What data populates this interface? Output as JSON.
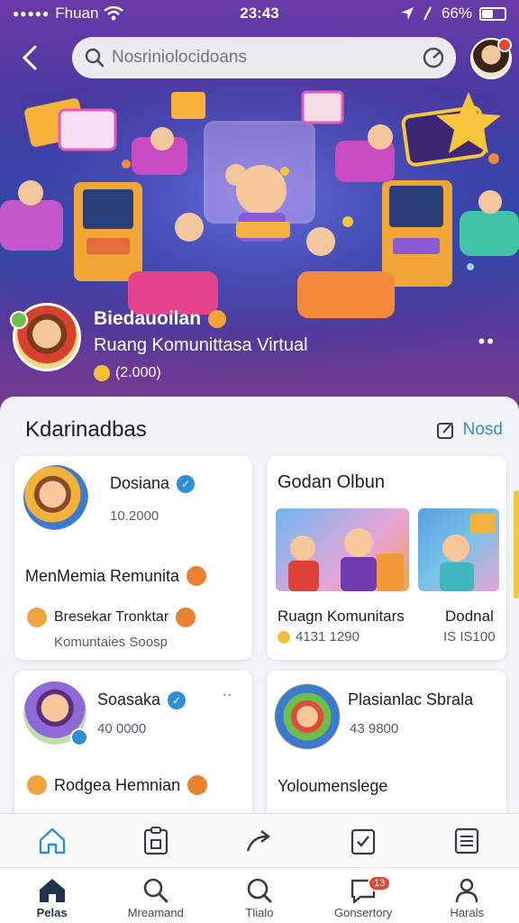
{
  "status_bar": {
    "carrier": "Fhuan",
    "time": "23:43",
    "battery": "66%"
  },
  "header": {
    "search_placeholder": "Nosriniolocidoans"
  },
  "hero": {
    "title": "Biedauoilan",
    "subtitle": "Ruang Komunittasa Virtual",
    "count": "(2.000)",
    "more": "••"
  },
  "section": {
    "title": "Kdarinadbas",
    "action_label": "Nosd"
  },
  "cards": [
    {
      "name": "Dosiana",
      "count": "10.2000",
      "line": "MenMemia Remunita",
      "tag": "Bresekar Tronktar",
      "sub": "Komuntaies Soosp"
    },
    {
      "title": "Godan Olbun",
      "caption_left": "Ruagn Komunitars",
      "caption_right": "Dodnal",
      "meta_left": "4131 1290",
      "meta_right": "IS IS100"
    },
    {
      "name": "Soasaka",
      "count": "40 0000",
      "line": "Rodgea Hemnian",
      "more": "··"
    },
    {
      "name": "Plasianlac Sbrala",
      "count": "43 9800",
      "line": "Yoloumenslege"
    }
  ],
  "nav": [
    {
      "label": "Pelas",
      "icon": "home-icon"
    },
    {
      "label": "Mreamand",
      "icon": "search-icon"
    },
    {
      "label": "Tlialo",
      "icon": "search-icon"
    },
    {
      "label": "Gonsertory",
      "icon": "chat-icon",
      "badge": "13"
    },
    {
      "label": "Harals",
      "icon": "profile-icon"
    }
  ],
  "colors": {
    "accent": "#2e8fd6",
    "badge": "#e8462e",
    "gradient_top": "#6a3aa8",
    "gradient_bottom": "#7b3a8e"
  }
}
